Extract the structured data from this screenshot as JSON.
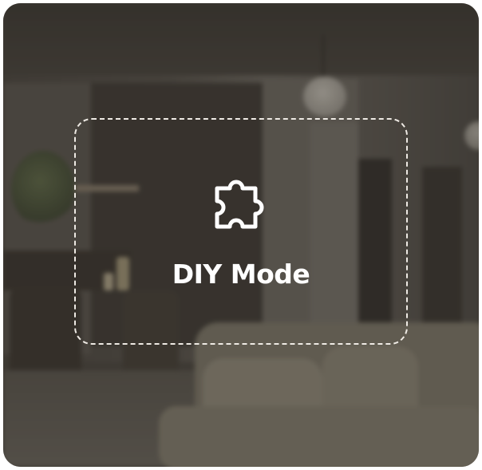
{
  "card": {
    "title": "DIY Mode",
    "icon": "puzzle-piece-icon",
    "background_image": "blurred-living-room-photo"
  },
  "colors": {
    "text": "#ffffff",
    "dashed_border": "#eeeae4",
    "overlay": "#28241f"
  }
}
